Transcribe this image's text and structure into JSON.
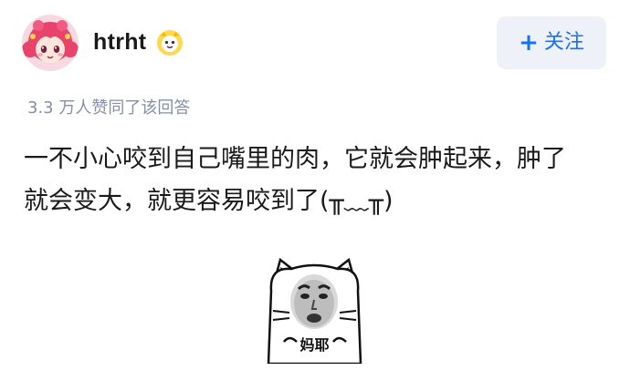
{
  "author": {
    "name": "htrht",
    "avatar_icon": "anime-girl-avatar-icon",
    "badge_icon": "creator-badge-icon"
  },
  "follow_button": {
    "icon": "plus-icon",
    "plus_glyph": "+",
    "label": "关注"
  },
  "meta": {
    "upvote_text": "3.3 万人赞同了该回答"
  },
  "answer": {
    "lines": [
      "一不小心咬到自己嘴里的肉，它就会肿起来，肿了",
      "就会变大，就更容易咬到了(╥﹏╥)"
    ]
  },
  "meme": {
    "icon": "panda-meme-face-icon",
    "caption": "妈耶"
  },
  "colors": {
    "accent": "#1772f6",
    "follow_bg": "#eef2f8",
    "meta_text": "#8590a6",
    "body_text": "#1a1a1a"
  }
}
